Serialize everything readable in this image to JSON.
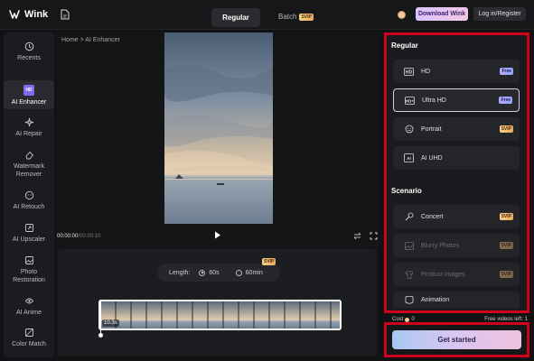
{
  "app": {
    "name": "Wink",
    "brand_gradient": [
      "#d8c3ff",
      "#f2c6e4"
    ],
    "highlight_color": "#d0021b"
  },
  "header": {
    "tabs": [
      {
        "label": "Regular",
        "active": true
      },
      {
        "label": "Batch",
        "badge": "SVIP",
        "active": false
      }
    ],
    "download_label": "Download Wink",
    "login_label": "Log in/Register"
  },
  "sidebar": {
    "items": [
      {
        "label": "Recents",
        "icon": "clock-icon"
      },
      {
        "label": "AI Enhancer",
        "icon": "hd-icon",
        "active": true,
        "icon_text": "HD"
      },
      {
        "label": "AI Repair",
        "icon": "repair-icon"
      },
      {
        "label": "Watermark\nRemover",
        "icon": "eraser-icon"
      },
      {
        "label": "AI Retouch",
        "icon": "retouch-face-icon"
      },
      {
        "label": "AI Upscaler",
        "icon": "upscale-icon"
      },
      {
        "label": "Photo\nRestoration",
        "icon": "photo-restore-icon"
      },
      {
        "label": "AI Anime",
        "icon": "anime-icon"
      },
      {
        "label": "Color Match",
        "icon": "color-match-icon"
      }
    ]
  },
  "main": {
    "breadcrumb": "Home > AI Enhancer",
    "time_current": "00:00:00",
    "time_total": "/00:00:10",
    "length_label": "Length:",
    "length_options": [
      {
        "label": "60s",
        "selected": true
      },
      {
        "label": "60min",
        "badge": "SVIP",
        "selected": false
      }
    ],
    "clip_duration": "10.3s"
  },
  "panel": {
    "regular_title": "Regular",
    "regular_options": [
      {
        "label": "HD",
        "icon": "hd-badge-icon",
        "badge": "Free",
        "selected": false
      },
      {
        "label": "Ultra HD",
        "icon": "hd-plus-icon",
        "badge": "Free",
        "selected": true
      },
      {
        "label": "Portrait",
        "icon": "face-smile-icon",
        "badge": "SVIP",
        "selected": false
      },
      {
        "label": "AI UHD",
        "icon": "ai-uhd-icon",
        "badge": "",
        "selected": false
      }
    ],
    "scenario_title": "Scenario",
    "scenario_options": [
      {
        "label": "Concert",
        "icon": "concert-icon",
        "badge": "SVIP",
        "disabled": false
      },
      {
        "label": "Blurry Photos",
        "icon": "image-icon",
        "badge": "SVIP",
        "disabled": true
      },
      {
        "label": "Product images",
        "icon": "shirt-icon",
        "badge": "SVIP",
        "disabled": true
      },
      {
        "label": "Animation",
        "icon": "animation-icon",
        "badge": "",
        "disabled": false
      }
    ],
    "cost_label": "Cost",
    "cost_value": "0",
    "free_left": "Free videos left: 1",
    "start_label": "Get started"
  }
}
